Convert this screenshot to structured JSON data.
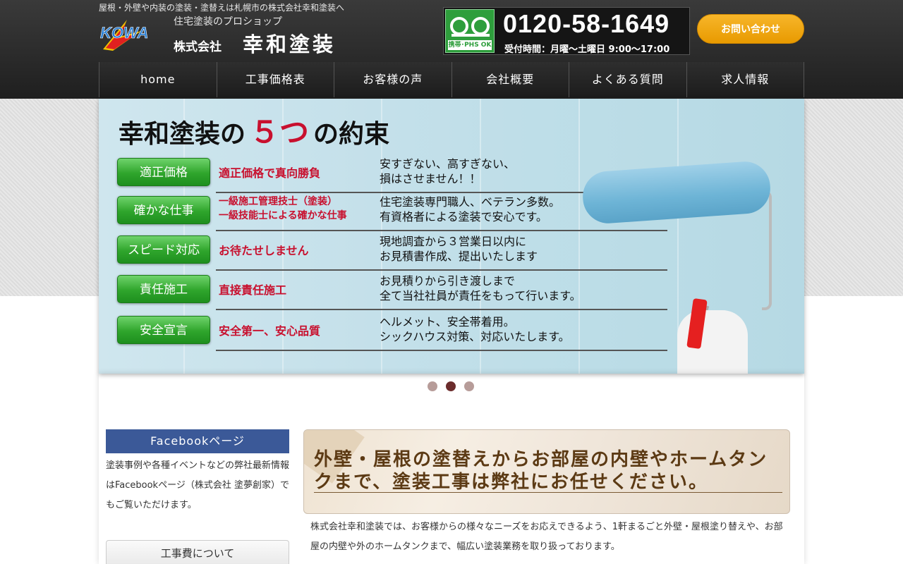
{
  "header": {
    "tagline": "屋根・外壁や内装の塗装・塗替えは札幌市の株式会社幸和塗装へ",
    "logo_mark": "KOWA",
    "logo_sub": "住宅塗装のプロショップ",
    "logo_kabu": "株式会社",
    "logo_name": "幸和塗装",
    "phone": "0120-58-1649",
    "phone_badge": "携帯･PHS OK",
    "phone_hours": "受付時間：月曜〜土曜日  9:00〜17:00",
    "contact_label": "お問い合わせ",
    "accent_color": "#f0a818"
  },
  "nav": {
    "items": [
      "home",
      "工事価格表",
      "お客様の声",
      "会社概要",
      "よくある質問",
      "求人情報"
    ]
  },
  "hero": {
    "title_pre": "幸和塗装の",
    "title_num": "５つ",
    "title_post": "の約束",
    "promises": [
      {
        "button": "適正価格",
        "head": "適正価格で真向勝負",
        "desc1": "安すぎない、高すぎない、",
        "desc2": "損はさせません！！"
      },
      {
        "button": "確かな仕事",
        "head": "一級施工管理技士（塗装）",
        "head2": "一級技能士による確かな仕事",
        "desc1": "住宅塗装専門職人、ベテラン多数。",
        "desc2": "有資格者による塗装で安心です。"
      },
      {
        "button": "スピード対応",
        "head": "お待たせしません",
        "desc1": "現地調査から３営業日以内に",
        "desc2": "お見積書作成、提出いたします"
      },
      {
        "button": "責任施工",
        "head": "直接責任施工",
        "desc1": "お見積りから引き渡しまで",
        "desc2": "全て当社社員が責任をもって行います。"
      },
      {
        "button": "安全宣言",
        "head": "安全第一、安心品質",
        "desc1": "ヘルメット、安全帯着用。",
        "desc2": "シックハウス対策、対応いたします。"
      }
    ],
    "slide_count": 3,
    "active_slide": 2
  },
  "sidebar": {
    "fb_title": "Facebookページ",
    "fb_text": "塗装事例や各種イベントなどの弊社最新情報はFacebookページ（株式会社 塗夢創家）でもご覧いただけます。",
    "box_title": "工事費について"
  },
  "main": {
    "banner": "外壁・屋根の塗替えからお部屋の内壁やホームタンクまで、塗装工事は弊社にお任せください。",
    "body": "株式会社幸和塗装では、お客様からの様々なニーズをお応えできるよう、1軒まるごと外壁・屋根塗り替えや、お部屋の内壁や外のホームタンクまで、幅広い塗装業務を取り扱っております。"
  }
}
